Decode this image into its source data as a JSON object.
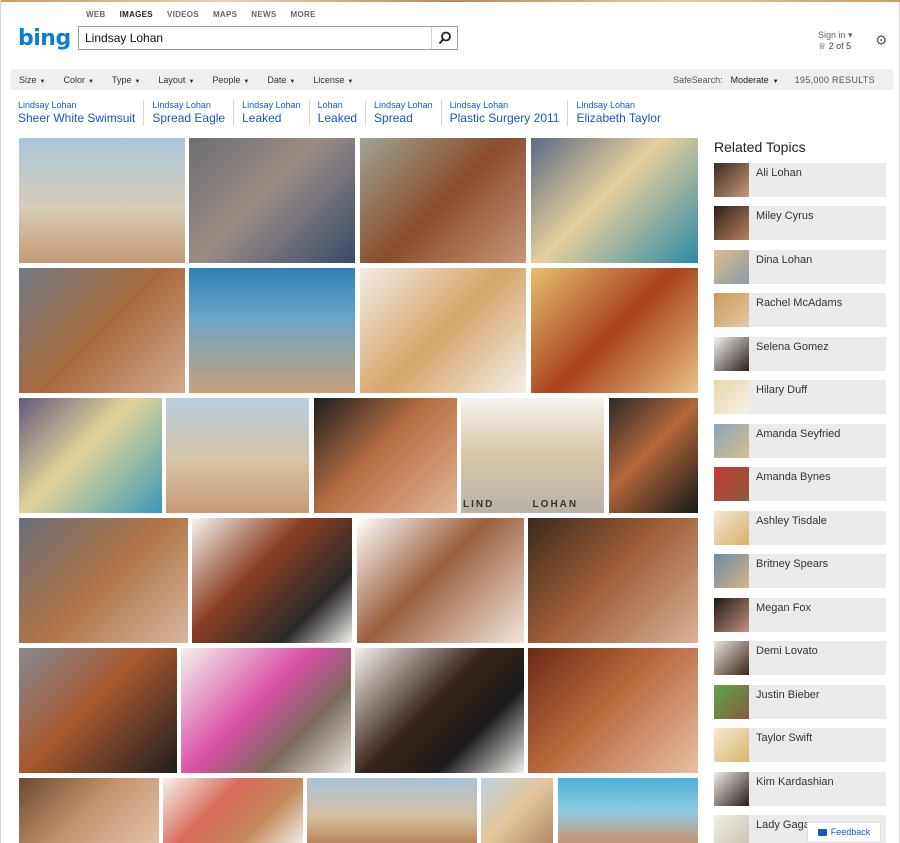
{
  "scope_nav": [
    {
      "label": "WEB",
      "active": false
    },
    {
      "label": "IMAGES",
      "active": true
    },
    {
      "label": "VIDEOS",
      "active": false
    },
    {
      "label": "MAPS",
      "active": false
    },
    {
      "label": "NEWS",
      "active": false
    },
    {
      "label": "MORE",
      "active": false
    }
  ],
  "logo": {
    "text": "bing",
    "color": "#0c7dd4"
  },
  "search": {
    "value": "Lindsay Lohan",
    "icon": "search-icon"
  },
  "account": {
    "signin_label": "Sign in ▾",
    "rewards_text": "2 of 5",
    "rewards_icon": "trophy-icon",
    "settings_icon": "gear-icon"
  },
  "filters": [
    {
      "label": "Size"
    },
    {
      "label": "Color"
    },
    {
      "label": "Type"
    },
    {
      "label": "Layout"
    },
    {
      "label": "People"
    },
    {
      "label": "Date"
    },
    {
      "label": "License"
    }
  ],
  "safesearch": {
    "label": "SafeSearch:",
    "value": "Moderate"
  },
  "results_count": "195,000 RESULTS",
  "related_searches": [
    {
      "prefix": "Lindsay Lohan",
      "term": "Sheer White Swimsuit"
    },
    {
      "prefix": "Lindsay Lohan",
      "term": "Spread Eagle"
    },
    {
      "prefix": "Lindsay Lohan",
      "term": "Leaked"
    },
    {
      "prefix": "Lohan",
      "term": "Leaked"
    },
    {
      "prefix": "Lindsay Lohan",
      "term": "Spread"
    },
    {
      "prefix": "Lindsay Lohan",
      "term": "Plastic Surgery 2011"
    },
    {
      "prefix": "Lindsay Lohan",
      "term": "Elizabeth Taylor"
    }
  ],
  "related_topics": {
    "title": "Related Topics",
    "items": [
      {
        "name": "Ali Lohan"
      },
      {
        "name": "Miley Cyrus"
      },
      {
        "name": "Dina Lohan"
      },
      {
        "name": "Rachel McAdams"
      },
      {
        "name": "Selena Gomez"
      },
      {
        "name": "Hilary Duff"
      },
      {
        "name": "Amanda Seyfried"
      },
      {
        "name": "Amanda Bynes"
      },
      {
        "name": "Ashley Tisdale"
      },
      {
        "name": "Britney Spears"
      },
      {
        "name": "Megan Fox"
      },
      {
        "name": "Demi Lovato"
      },
      {
        "name": "Justin Bieber"
      },
      {
        "name": "Taylor Swift"
      },
      {
        "name": "Kim Kardashian"
      },
      {
        "name": "Lady Gaga"
      }
    ]
  },
  "thumbnail_watermark": "LIND        LOHAN",
  "feedback_label": "Feedback"
}
